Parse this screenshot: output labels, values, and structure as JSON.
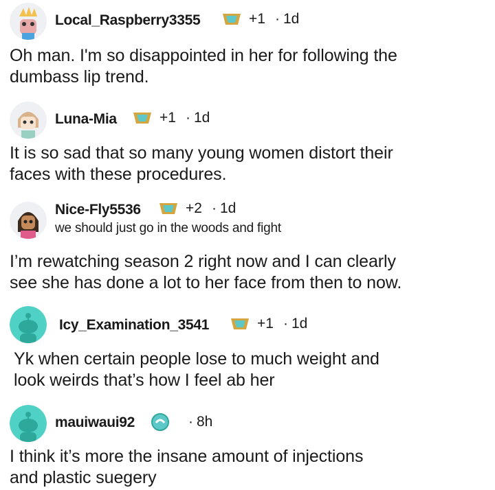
{
  "comments": [
    {
      "username": "Local_Raspberry3355",
      "score": "+1",
      "age": "1d",
      "text_lines": [
        "Oh man. I'm so disappointed in her for following the",
        "dumbass lip trend."
      ]
    },
    {
      "username": "Luna-Mia",
      "score": "+1",
      "age": "1d",
      "text_lines": [
        "It is so sad that so many young women distort their",
        "faces with these procedures."
      ]
    },
    {
      "username": "Nice-Fly5536",
      "score": "+2",
      "age": "1d",
      "flair": "we should just go in the woods and fight",
      "text_lines": [
        "I’m rewatching season 2 right now and I can clearly",
        "see she has done a lot to her face from then to now."
      ]
    },
    {
      "username": "Icy_Examination_3541",
      "score": "+1",
      "age": "1d",
      "text_lines": [
        "Yk when certain people lose to much weight and",
        "look weirds that’s how I feel ab her"
      ]
    },
    {
      "username": "mauiwaui92",
      "age": "8h",
      "text_lines": [
        "I think it’s more the insane amount of injections",
        "and plastic suegery"
      ]
    }
  ],
  "separator": "·",
  "colors": {
    "text": "#1a1a1b",
    "avatar_teal": "#4fd1c5",
    "avatar_light": "#e8f4f8",
    "award_gold": "#d4a640",
    "award_teal": "#5ec8c8"
  }
}
